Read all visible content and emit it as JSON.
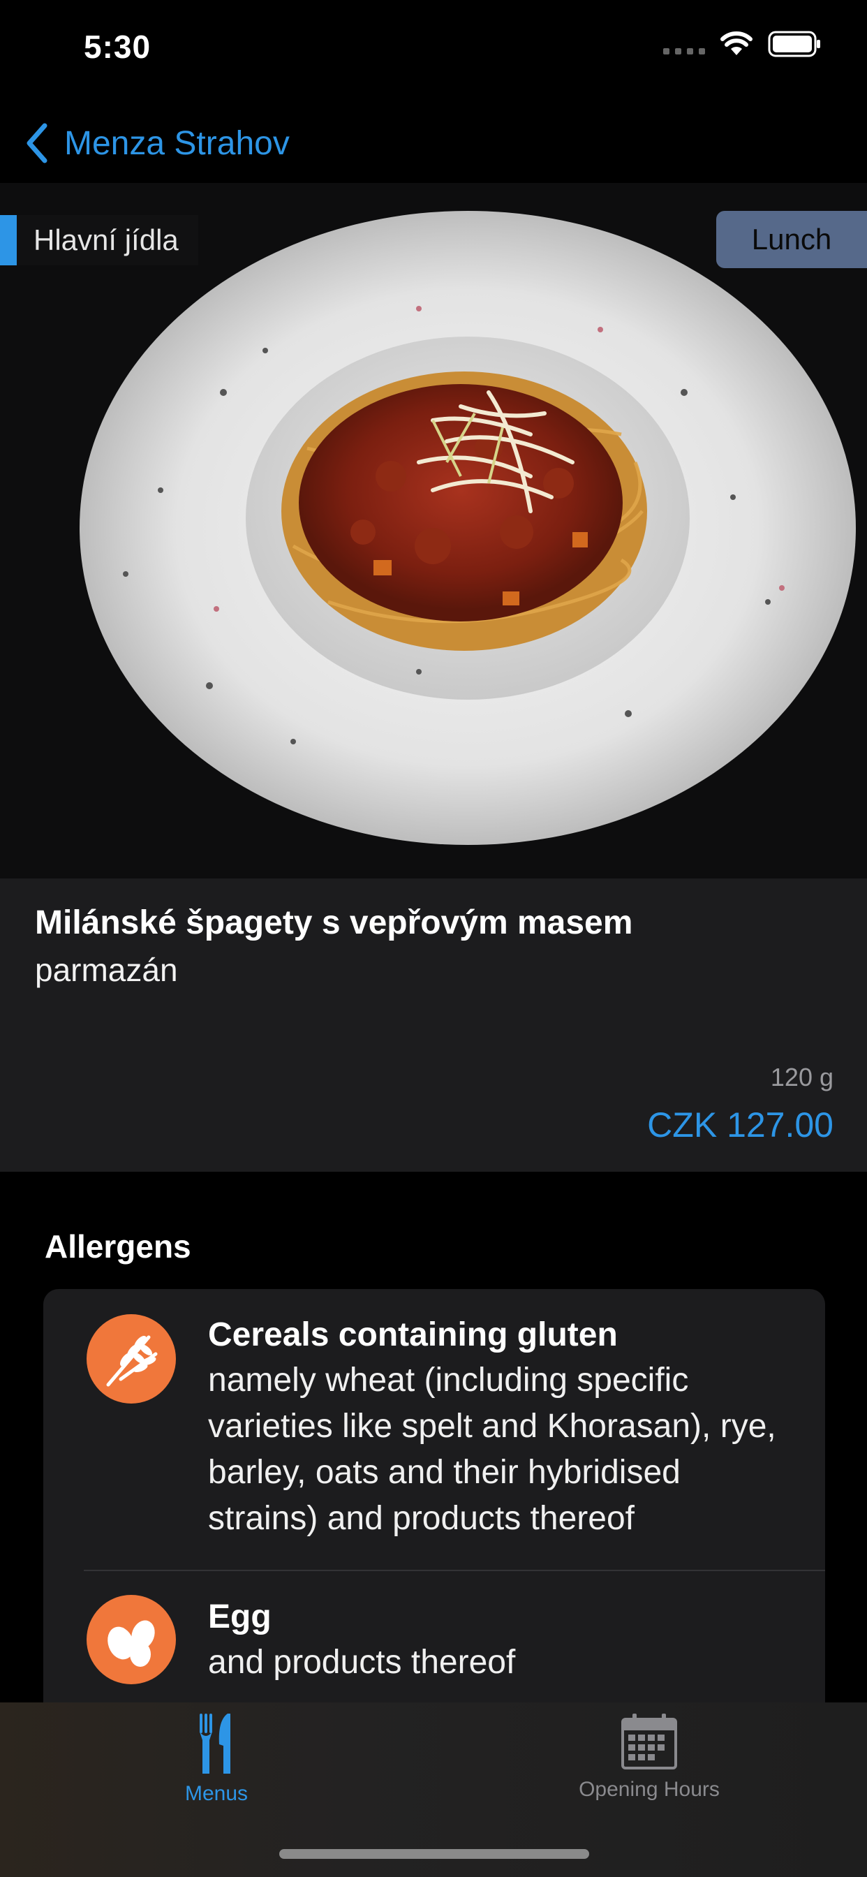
{
  "status": {
    "time": "5:30"
  },
  "nav": {
    "back_label": "Menza Strahov"
  },
  "hero": {
    "category": "Hlavní jídla",
    "meal": "Lunch"
  },
  "dish": {
    "name": "Milánské špagety s vepřovým masem",
    "side": "parmazán",
    "weight": "120 g",
    "price": "CZK 127.00"
  },
  "allergens": {
    "title": "Allergens",
    "items": [
      {
        "icon": "wheat-icon",
        "title": "Cereals containing gluten",
        "description": "namely wheat (including specific varieties like spelt and Khorasan), rye, barley, oats and their hybridised strains) and products thereof"
      },
      {
        "icon": "egg-icon",
        "title": "Egg",
        "description": "and products thereof"
      }
    ]
  },
  "tabs": [
    {
      "label": "Menus",
      "icon": "fork-knife-icon",
      "active": true
    },
    {
      "label": "Opening Hours",
      "icon": "calendar-icon",
      "active": false
    }
  ],
  "colors": {
    "accent": "#2D95E6",
    "allergen_icon_bg": "#F0773B",
    "card": "#1C1C1E"
  }
}
